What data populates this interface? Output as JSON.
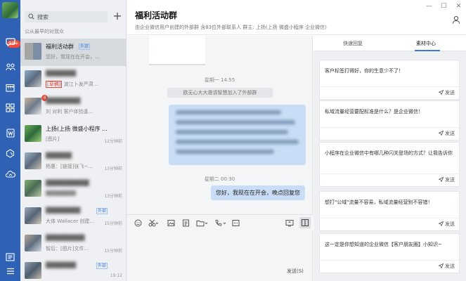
{
  "rail": {
    "badge": "99+",
    "icons": [
      "message-icon",
      "contacts-icon",
      "calendar-icon",
      "apps-icon",
      "doc-icon",
      "cube-icon",
      "cloud-icon",
      "settings-icon",
      "menu-icon"
    ]
  },
  "list": {
    "search_placeholder": "搜索",
    "recent_hint": "公从最早的对我众",
    "items": [
      {
        "title": "福利活动群",
        "tag": "外部",
        "preview": "您好，我现在在开会，...",
        "time": ""
      },
      {
        "title": "",
        "preview_tag": "[草稿]",
        "preview": "渡江卜发严肃...",
        "time": ""
      },
      {
        "title": "",
        "preview": "刘 对利 客户体验逢...",
        "time": "",
        "unread": "4"
      },
      {
        "title": "上扬(上扬 微盛小程序 ...",
        "preview": "[图片]",
        "time": "12分钟前"
      },
      {
        "title": "",
        "preview": "杨惠：[链接]张飞~...",
        "time": "13分钟前"
      },
      {
        "title": "",
        "preview": "",
        "time": "13分钟前"
      },
      {
        "title": "",
        "tag": "外部",
        "preview": "大体 Wallacer 创建...",
        "time": "15分钟前"
      },
      {
        "title": "",
        "preview": "智后：[图片]文件...",
        "time": "15分钟前"
      },
      {
        "title": "",
        "tag": "外部",
        "preview": "",
        "time": "19:12"
      }
    ]
  },
  "chat": {
    "name": "福利活动群",
    "subtitle": "由企业微信用户创建的外部群  含83位外部联系人 群主: 上扬(上扬 微盛小程序 企业微信)",
    "ts1": "星期一 14:55",
    "system_msg": "欧无心大大邀请智慧加入了外部群",
    "ts2": "星期二 00:30",
    "reply": "您好，我现在在开会，晚点回复您",
    "send_label": "发送(S)"
  },
  "panel": {
    "tabs": [
      "快速回复",
      "素材中心"
    ],
    "send_label": "发送",
    "cards": [
      "客户标签打得好，你的生意少不了！",
      "私域流量经营要配标准是什么？是企业微信！",
      "小程序在企业微信中有哪几种闪关登场的方式？让我告诉你",
      "想打\"公域\"流量不容易，私域流量经营别不容错！",
      "这一定是你想知道的企业微信【客户朋友圈】小知识~"
    ]
  },
  "colors": {
    "rail": "#2f61b5",
    "accent": "#3a7bd5",
    "bubble": "#c9def6",
    "badge": "#f04b3a"
  }
}
